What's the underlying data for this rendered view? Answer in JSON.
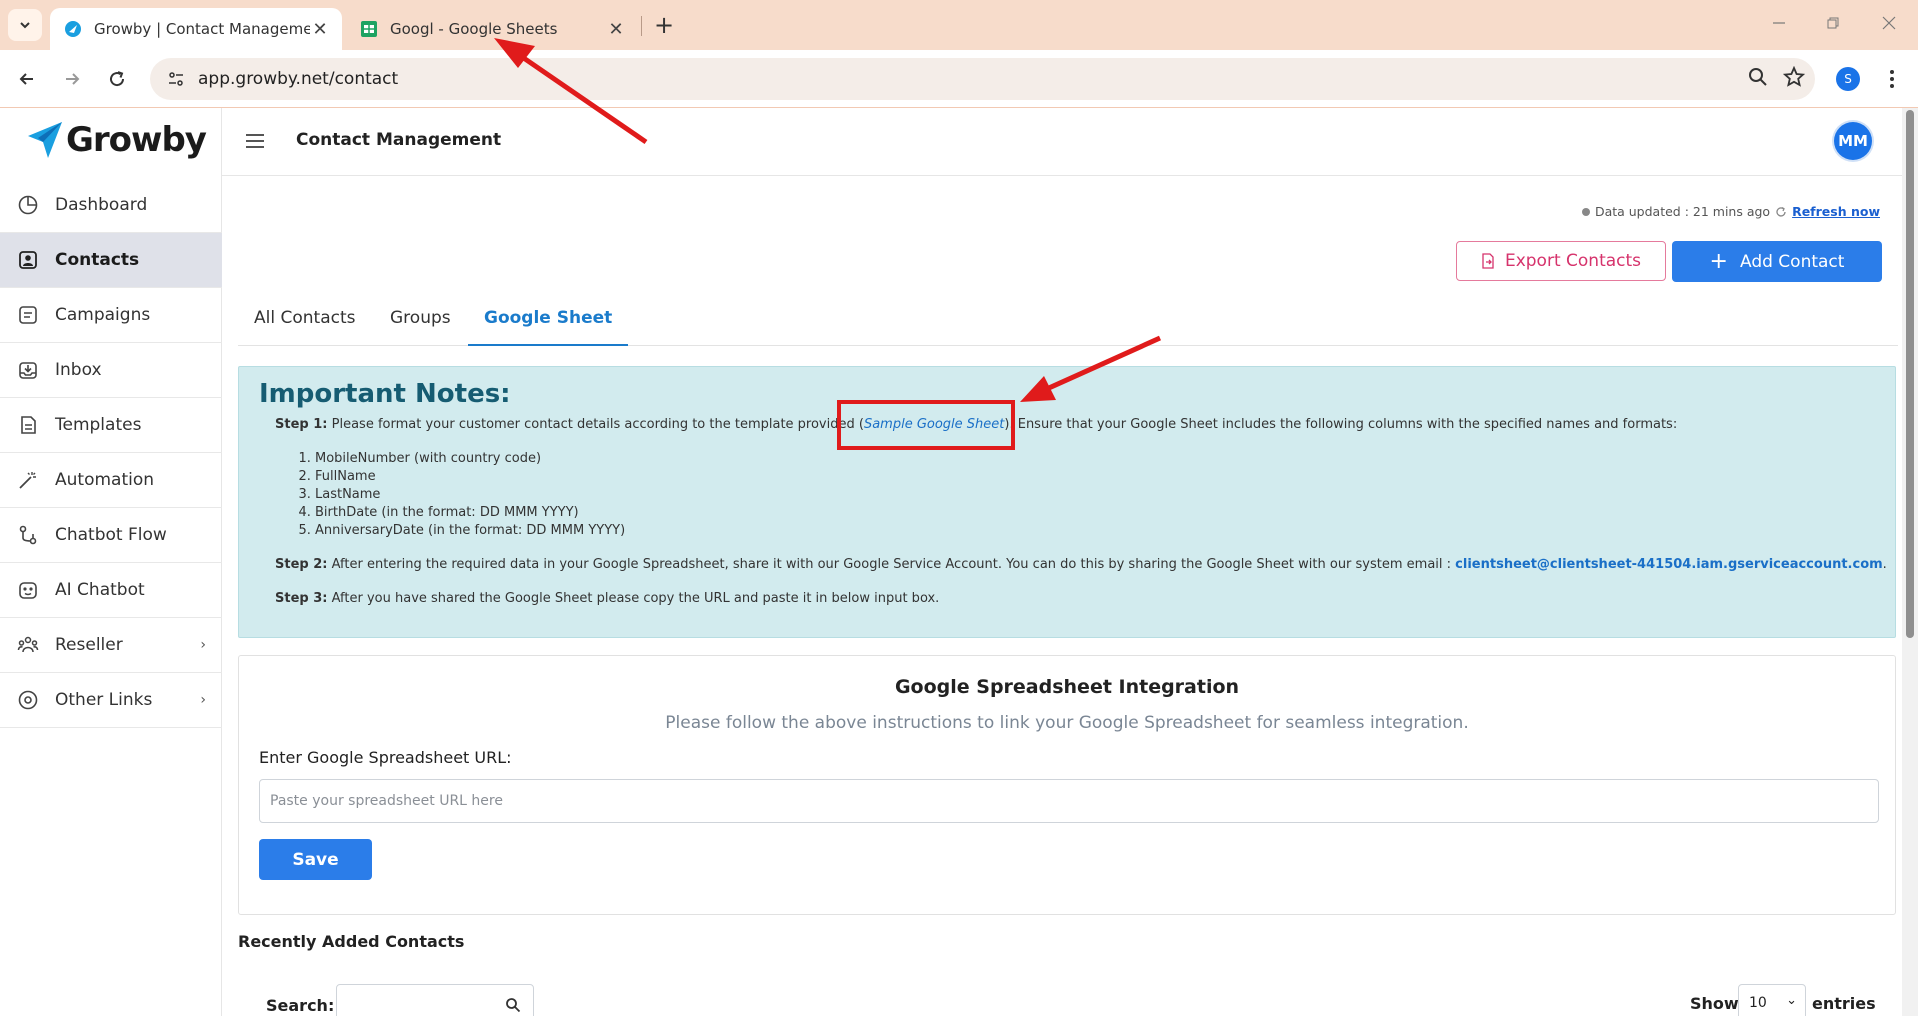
{
  "browser": {
    "tabs": [
      {
        "title": "Growby | Contact Management",
        "active": true,
        "favicon": "growby-favicon"
      },
      {
        "title": "Googl - Google Sheets",
        "active": false,
        "favicon": "google-sheets-icon"
      }
    ],
    "url": "app.growby.net/contact",
    "profile_initial": "S"
  },
  "sidebar": {
    "logo_text": "Growby",
    "items": [
      {
        "label": "Dashboard",
        "icon": "pie-chart-icon"
      },
      {
        "label": "Contacts",
        "icon": "contacts-icon",
        "active": true
      },
      {
        "label": "Campaigns",
        "icon": "campaigns-icon"
      },
      {
        "label": "Inbox",
        "icon": "inbox-icon"
      },
      {
        "label": "Templates",
        "icon": "templates-icon"
      },
      {
        "label": "Automation",
        "icon": "magic-wand-icon"
      },
      {
        "label": "Chatbot Flow",
        "icon": "flow-icon"
      },
      {
        "label": "AI Chatbot",
        "icon": "robot-icon"
      },
      {
        "label": "Reseller",
        "icon": "reseller-icon",
        "has_submenu": true
      },
      {
        "label": "Other Links",
        "icon": "compass-icon",
        "has_submenu": true
      }
    ]
  },
  "header": {
    "title": "Contact Management",
    "avatar_initials": "MM"
  },
  "status": {
    "text": "Data updated : 21 mins ago",
    "refresh_label": "Refresh now"
  },
  "actions": {
    "export_label": "Export Contacts",
    "add_label": "Add Contact"
  },
  "content_tabs": [
    {
      "label": "All Contacts"
    },
    {
      "label": "Groups"
    },
    {
      "label": "Google Sheet",
      "active": true
    }
  ],
  "notes": {
    "title": "Important Notes:",
    "step1_label": "Step 1:",
    "step1_text_a": "Please format your customer contact details according to the template provided (",
    "step1_link": "Sample Google Sheet",
    "step1_text_b": "). Ensure that your Google Sheet includes the following columns with the specified names and formats:",
    "columns": [
      "MobileNumber (with country code)",
      "FullName",
      "LastName",
      "BirthDate (in the format: DD MMM YYYY)",
      "AnniversaryDate (in the format: DD MMM YYYY)"
    ],
    "step2_label": "Step 2:",
    "step2_text": "After entering the required data in your Google Spreadsheet, share it with our Google Service Account. You can do this by sharing the Google Sheet with our system email :",
    "step2_email": "clientsheet@clientsheet-441504.iam.gserviceaccount.com",
    "step2_end": ".",
    "step3_label": "Step 3:",
    "step3_text": "After you have shared the Google Sheet please copy the URL and paste it in below input box."
  },
  "integration": {
    "title": "Google Spreadsheet Integration",
    "subtitle": "Please follow the above instructions to link your Google Spreadsheet for seamless integration.",
    "url_label": "Enter Google Spreadsheet URL:",
    "url_placeholder": "Paste your spreadsheet URL here",
    "url_value": "",
    "save_label": "Save"
  },
  "recent": {
    "title": "Recently Added Contacts",
    "search_label": "Search:",
    "show_label": "Show",
    "entries_value": "10",
    "entries_label": "entries"
  },
  "colors": {
    "accent": "#2b7de9",
    "annotation_red": "#e01b1b",
    "notes_bg": "#d2ebee",
    "tabstrip_bg": "#f7dccb"
  }
}
